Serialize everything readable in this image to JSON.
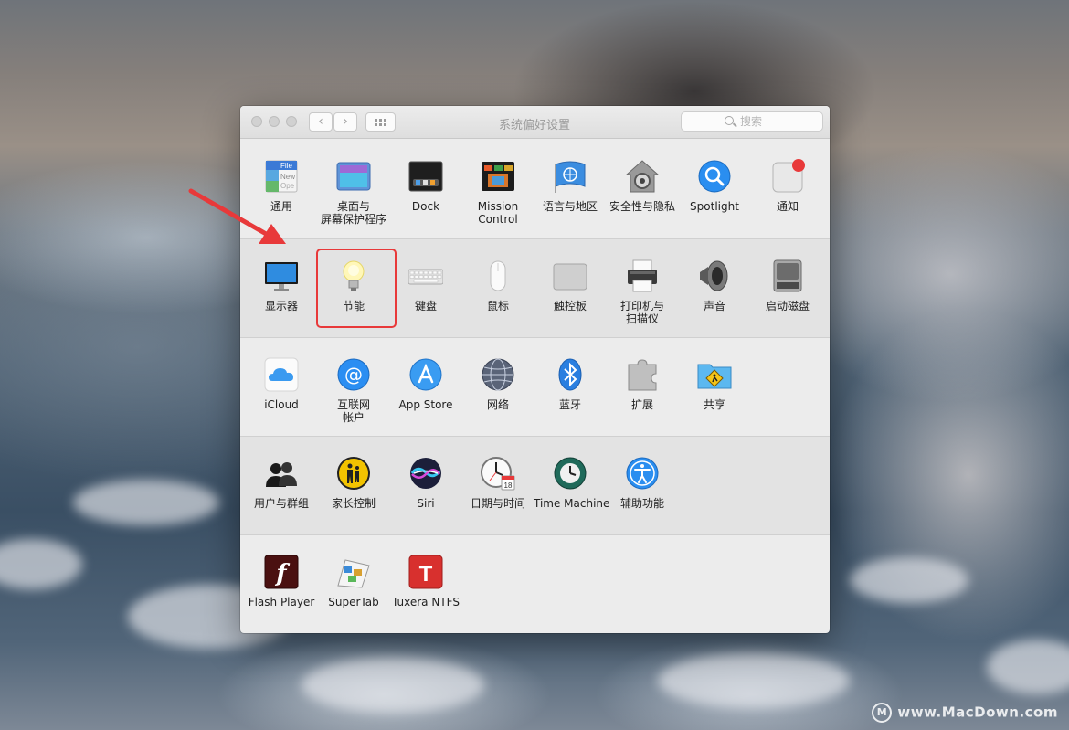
{
  "window": {
    "title": "系统偏好设置",
    "search_placeholder": "搜索"
  },
  "rows": [
    {
      "items": [
        {
          "label": "通用",
          "icon": "general-icon"
        },
        {
          "label": "桌面与",
          "label2": "屏幕保护程序",
          "icon": "desktop-screensaver-icon"
        },
        {
          "label": "Dock",
          "icon": "dock-icon"
        },
        {
          "label": "Mission",
          "label2": "Control",
          "icon": "mission-control-icon"
        },
        {
          "label": "语言与地区",
          "icon": "language-region-icon"
        },
        {
          "label": "安全性与隐私",
          "icon": "security-privacy-icon"
        },
        {
          "label": "Spotlight",
          "icon": "spotlight-icon"
        },
        {
          "label": "通知",
          "icon": "notifications-icon"
        }
      ]
    },
    {
      "items": [
        {
          "label": "显示器",
          "icon": "displays-icon"
        },
        {
          "label": "节能",
          "icon": "energy-saver-icon"
        },
        {
          "label": "键盘",
          "icon": "keyboard-icon"
        },
        {
          "label": "鼠标",
          "icon": "mouse-icon"
        },
        {
          "label": "触控板",
          "icon": "trackpad-icon"
        },
        {
          "label": "打印机与",
          "label2": "扫描仪",
          "icon": "printers-scanners-icon"
        },
        {
          "label": "声音",
          "icon": "sound-icon"
        },
        {
          "label": "启动磁盘",
          "icon": "startup-disk-icon"
        }
      ]
    },
    {
      "items": [
        {
          "label": "iCloud",
          "icon": "icloud-icon"
        },
        {
          "label": "互联网",
          "label2": "帐户",
          "icon": "internet-accounts-icon"
        },
        {
          "label": "App Store",
          "icon": "app-store-icon"
        },
        {
          "label": "网络",
          "icon": "network-icon"
        },
        {
          "label": "蓝牙",
          "icon": "bluetooth-icon"
        },
        {
          "label": "扩展",
          "icon": "extensions-icon"
        },
        {
          "label": "共享",
          "icon": "sharing-icon"
        }
      ]
    },
    {
      "items": [
        {
          "label": "用户与群组",
          "icon": "users-groups-icon"
        },
        {
          "label": "家长控制",
          "icon": "parental-controls-icon"
        },
        {
          "label": "Siri",
          "icon": "siri-icon"
        },
        {
          "label": "日期与时间",
          "icon": "date-time-icon"
        },
        {
          "label": "Time Machine",
          "icon": "time-machine-icon"
        },
        {
          "label": "辅助功能",
          "icon": "accessibility-icon"
        }
      ]
    },
    {
      "items": [
        {
          "label": "Flash Player",
          "icon": "flash-player-icon"
        },
        {
          "label": "SuperTab",
          "icon": "supertab-icon"
        },
        {
          "label": "Tuxera NTFS",
          "icon": "tuxera-ntfs-icon"
        }
      ]
    }
  ],
  "icon_text": {
    "general_file": "File",
    "general_new": "New",
    "general_ope": "Ope",
    "calendar_day": "18",
    "flash_letter": "f",
    "tuxera_letter": "T",
    "at_sign": "@"
  },
  "highlight_target": "节能",
  "watermark": "www.MacDown.com",
  "watermark_logo": "M",
  "colors": {
    "highlight": "#e8393a",
    "arrow": "#e8393a"
  }
}
